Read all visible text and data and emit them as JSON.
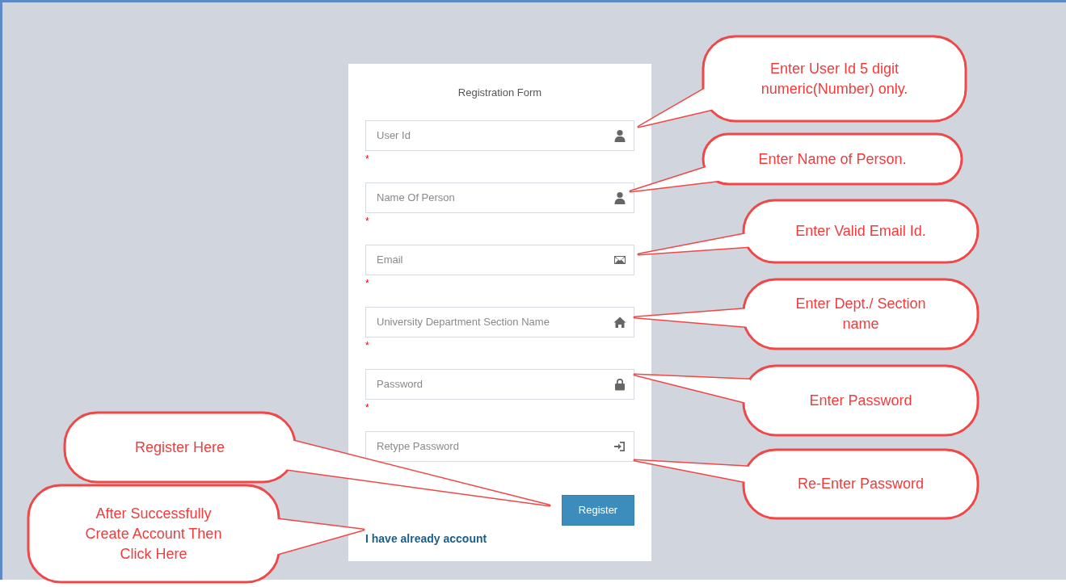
{
  "form": {
    "title": "Registration Form",
    "fields": [
      {
        "placeholder": "User Id",
        "kind": "user",
        "required_mark": "*"
      },
      {
        "placeholder": "Name Of Person",
        "kind": "user",
        "required_mark": "*"
      },
      {
        "placeholder": "Email",
        "kind": "email",
        "required_mark": "*"
      },
      {
        "placeholder": "University Department Section Name",
        "kind": "department",
        "required_mark": "*"
      },
      {
        "placeholder": "Password",
        "kind": "password",
        "required_mark": "*"
      },
      {
        "placeholder": "Retype Password",
        "kind": "confirm"
      }
    ],
    "button": "Register",
    "link": "I have already account"
  },
  "callouts": [
    {
      "lines": [
        "Enter User Id 5 digit",
        "numeric(Number) only."
      ]
    },
    {
      "lines": [
        "Enter Name of Person."
      ]
    },
    {
      "lines": [
        "Enter Valid Email Id."
      ]
    },
    {
      "lines": [
        "Enter Dept./ Section",
        "name"
      ]
    },
    {
      "lines": [
        "Enter Password"
      ]
    },
    {
      "lines": [
        "Re-Enter Password"
      ]
    },
    {
      "lines": [
        "Register Here"
      ]
    },
    {
      "lines": [
        "After Successfully",
        "Create Account Then",
        "Click Here"
      ]
    }
  ]
}
